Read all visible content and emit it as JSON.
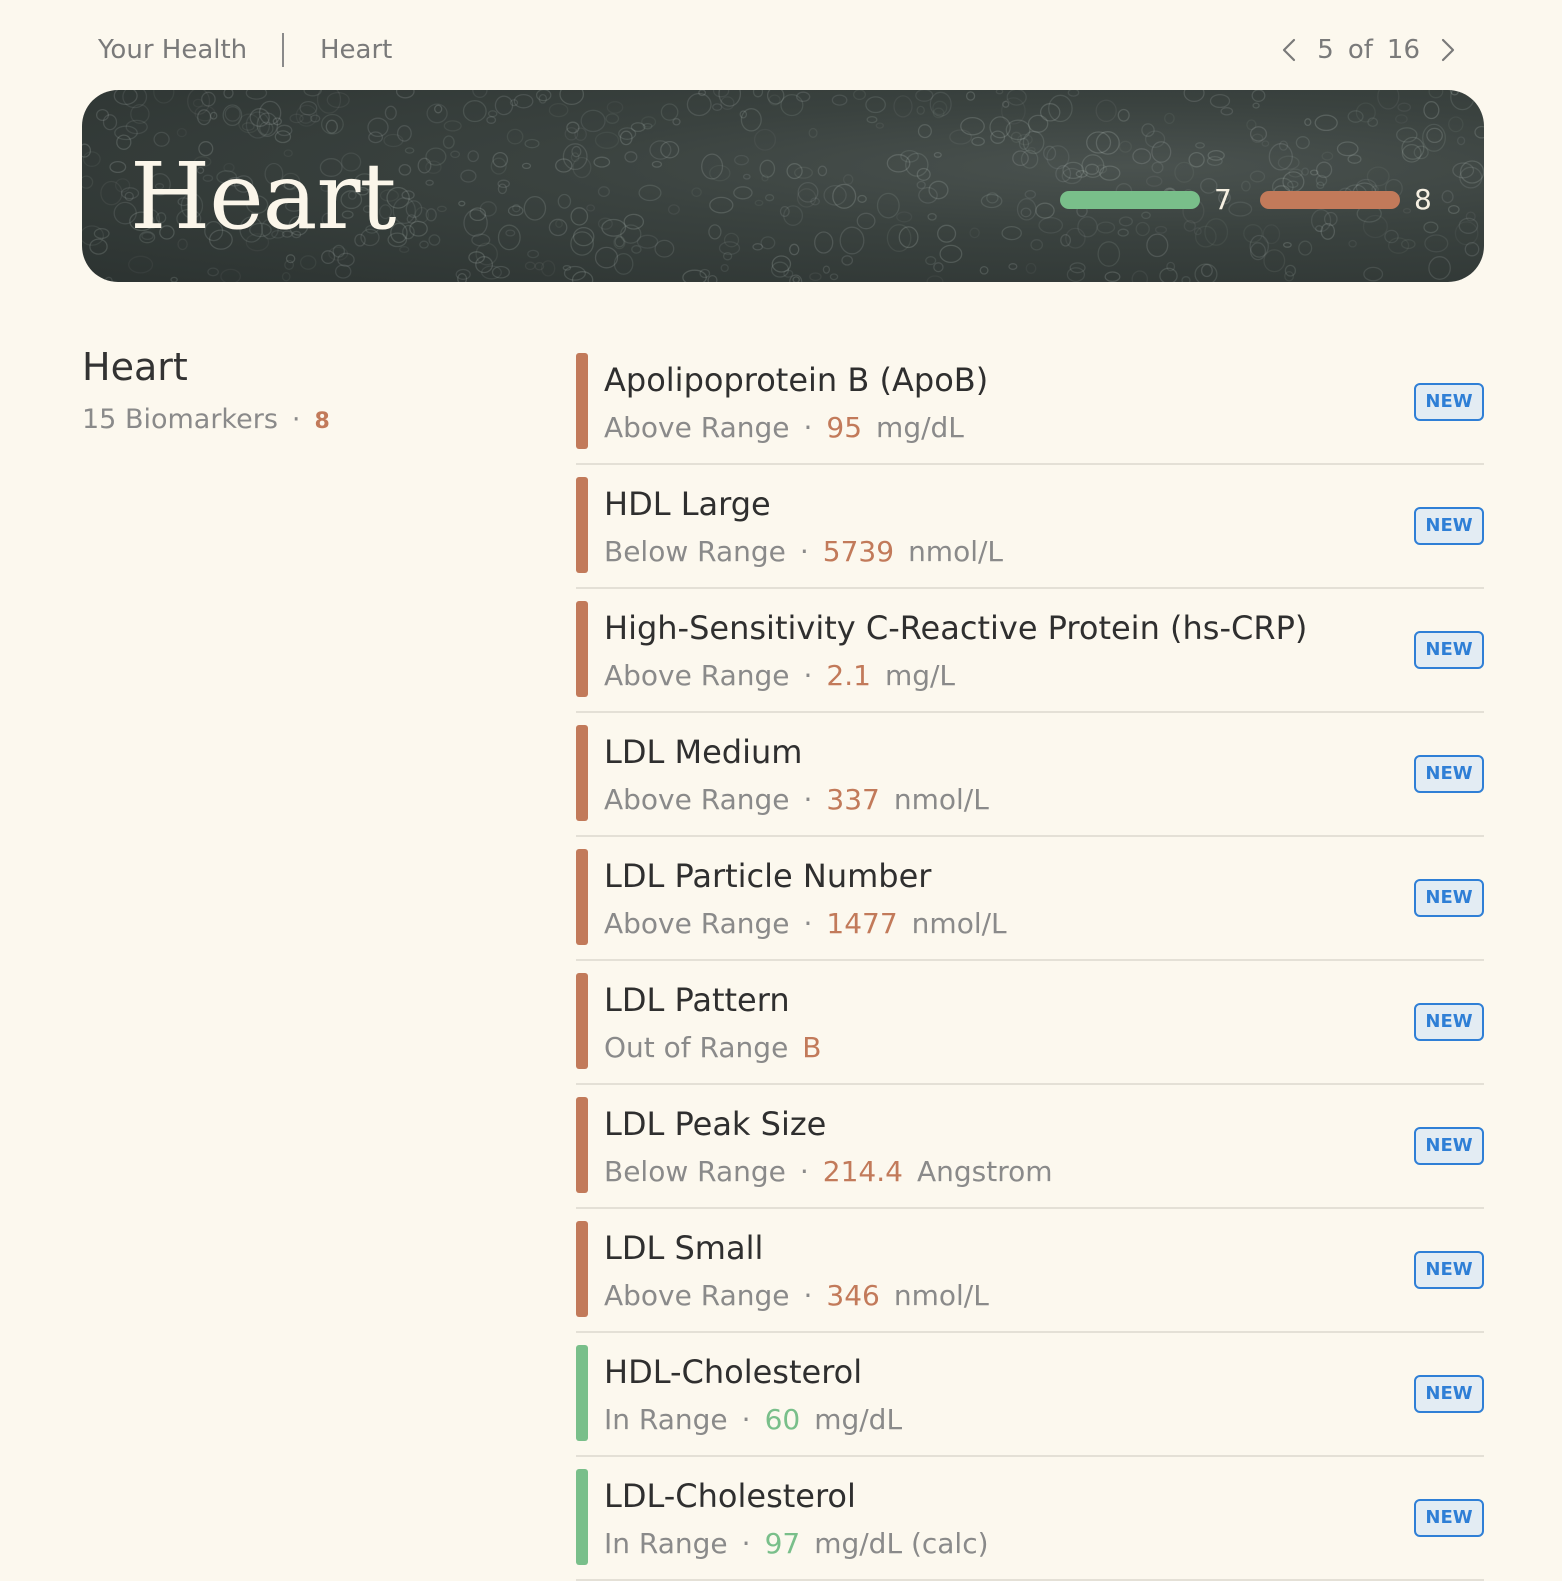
{
  "breadcrumb": {
    "home": "Your Health",
    "current": "Heart"
  },
  "pager": {
    "current": "5",
    "of": "of",
    "total": "16"
  },
  "hero": {
    "title": "Heart",
    "in_range_count": "7",
    "out_range_count": "8"
  },
  "summary": {
    "title": "Heart",
    "biomarkers": "15 Biomarkers",
    "flagged": "8"
  },
  "colors": {
    "out_of_range": "#c27a5a",
    "in_range": "#79bf8a",
    "badge": "#2f7fd6"
  },
  "biomarkers": [
    {
      "name": "Apolipoprotein B (ApoB)",
      "status": "Above Range",
      "value": "95",
      "unit": "mg/dL",
      "badge": "NEW"
    },
    {
      "name": "HDL Large",
      "status": "Below Range",
      "value": "5739",
      "unit": "nmol/L",
      "badge": "NEW"
    },
    {
      "name": "High-Sensitivity C-Reactive Protein (hs-CRP)",
      "status": "Above Range",
      "value": "2.1",
      "unit": "mg/L",
      "badge": "NEW"
    },
    {
      "name": "LDL Medium",
      "status": "Above Range",
      "value": "337",
      "unit": "nmol/L",
      "badge": "NEW"
    },
    {
      "name": "LDL Particle Number",
      "status": "Above Range",
      "value": "1477",
      "unit": "nmol/L",
      "badge": "NEW"
    },
    {
      "name": "LDL Pattern",
      "status": "Out of Range",
      "value": "B",
      "unit": "",
      "badge": "NEW"
    },
    {
      "name": "LDL Peak Size",
      "status": "Below Range",
      "value": "214.4",
      "unit": "Angstrom",
      "badge": "NEW"
    },
    {
      "name": "LDL Small",
      "status": "Above Range",
      "value": "346",
      "unit": "nmol/L",
      "badge": "NEW"
    },
    {
      "name": "HDL-Cholesterol",
      "status": "In Range",
      "value": "60",
      "unit": "mg/dL",
      "badge": "NEW"
    },
    {
      "name": "LDL-Cholesterol",
      "status": "In Range",
      "value": "97",
      "unit": "mg/dL (calc)",
      "badge": "NEW"
    }
  ]
}
